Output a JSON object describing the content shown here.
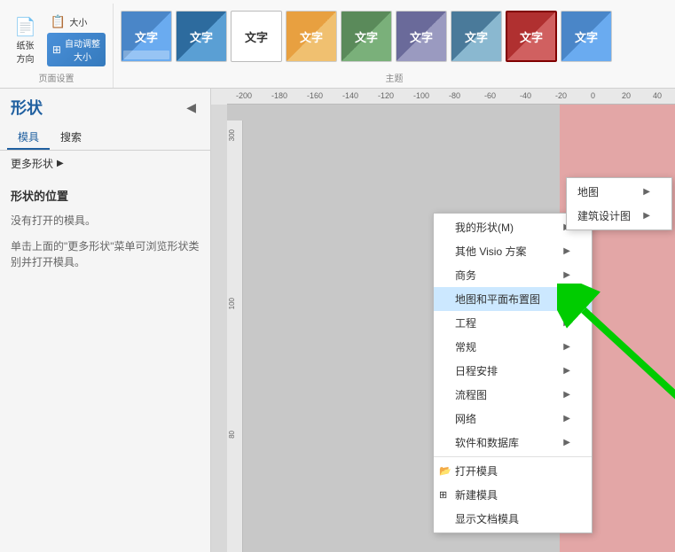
{
  "ribbon": {
    "page_setup": {
      "label": "页面设置",
      "buttons": [
        {
          "id": "paper-direction",
          "label": "纸张\n方向",
          "icon": "📄"
        },
        {
          "id": "paper-size",
          "label": "大小",
          "icon": "📋"
        },
        {
          "id": "auto-adjust",
          "label": "自动调整\n大小",
          "icon": "⊞"
        }
      ],
      "section_label": "页面设置"
    },
    "theme": {
      "label": "主题",
      "section_label": "主题",
      "buttons": [
        {
          "id": "t1",
          "label": "文字",
          "style": "theme-btn-1"
        },
        {
          "id": "t2",
          "label": "文字",
          "style": "theme-btn-2"
        },
        {
          "id": "t3",
          "label": "文字",
          "style": "theme-btn-3"
        },
        {
          "id": "t4",
          "label": "文字",
          "style": "theme-btn-4"
        },
        {
          "id": "t5",
          "label": "文字",
          "style": "theme-btn-5"
        },
        {
          "id": "t6",
          "label": "文字",
          "style": "theme-btn-6"
        },
        {
          "id": "t7",
          "label": "文字",
          "style": "theme-btn-7"
        },
        {
          "id": "t8",
          "label": "文字",
          "style": "theme-btn-8"
        },
        {
          "id": "t9",
          "label": "文字",
          "style": "theme-btn-9"
        }
      ]
    }
  },
  "sidebar": {
    "title": "形状",
    "tabs": [
      {
        "label": "模具",
        "active": true
      },
      {
        "label": "搜索",
        "active": false
      }
    ],
    "more_shapes": "更多形状",
    "shape_location_title": "形状的位置",
    "no_model_text": "没有打开的模具。",
    "hint_text": "单击上面的\"更多形状\"菜单可浏览形状类别并打开模具。"
  },
  "context_menu": {
    "items": [
      {
        "id": "my-shapes",
        "label": "我的形状(M)",
        "has_arrow": true,
        "icon": ""
      },
      {
        "id": "other-visio",
        "label": "其他 Visio 方案",
        "has_arrow": true,
        "icon": ""
      },
      {
        "id": "business",
        "label": "商务",
        "has_arrow": true,
        "icon": ""
      },
      {
        "id": "maps-floor",
        "label": "地图和平面布置图",
        "has_arrow": true,
        "highlighted": true,
        "icon": ""
      },
      {
        "id": "engineering",
        "label": "工程",
        "has_arrow": true,
        "icon": ""
      },
      {
        "id": "general",
        "label": "常规",
        "has_arrow": true,
        "icon": ""
      },
      {
        "id": "schedule",
        "label": "日程安排",
        "has_arrow": true,
        "icon": ""
      },
      {
        "id": "flowchart",
        "label": "流程图",
        "has_arrow": true,
        "icon": ""
      },
      {
        "id": "network",
        "label": "网络",
        "has_arrow": true,
        "icon": ""
      },
      {
        "id": "software-db",
        "label": "软件和数据库",
        "has_arrow": true,
        "icon": ""
      },
      {
        "id": "open-stencil",
        "label": "打开模具",
        "has_arrow": false,
        "icon": "📂"
      },
      {
        "id": "new-stencil",
        "label": "新建模具",
        "has_arrow": false,
        "icon": "⊞"
      },
      {
        "id": "show-doc-stencil",
        "label": "显示文档模具",
        "has_arrow": false,
        "icon": ""
      }
    ]
  },
  "sub_menu": {
    "items": [
      {
        "id": "map",
        "label": "地图",
        "has_arrow": true
      },
      {
        "id": "architecture",
        "label": "建筑设计图",
        "has_arrow": true
      }
    ]
  },
  "ruler": {
    "top_ticks": [
      "-200",
      "-180",
      "-160",
      "-140",
      "-120",
      "-100",
      "-80",
      "-60",
      "-40",
      "-20",
      "0",
      "20",
      "40"
    ],
    "left_ticks": [
      "300",
      "100",
      "80"
    ]
  },
  "colors": {
    "accent": "#2060a0",
    "canvas_bg": "#c8c8c8",
    "shape_fill": "#e8a0a0",
    "highlighted_menu": "#cce8ff"
  }
}
